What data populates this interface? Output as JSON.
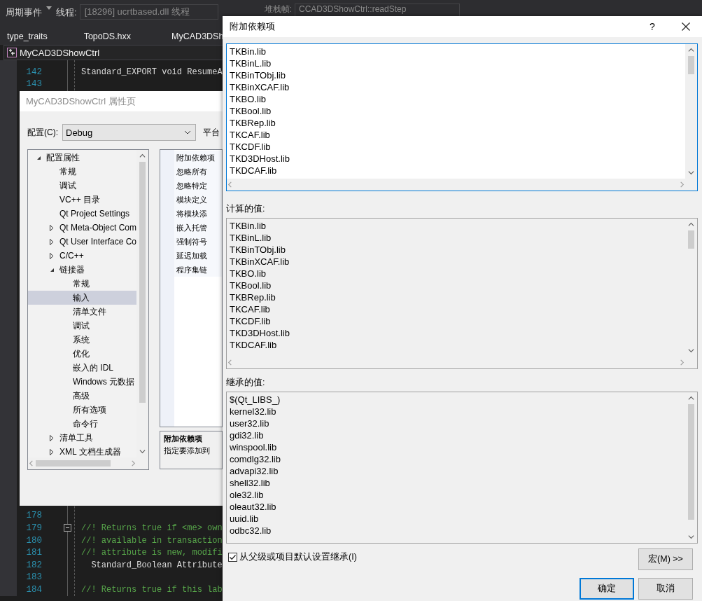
{
  "toolbar": {
    "event_label": "周期事件",
    "thread_label": "线程:",
    "thread_value": "[18296] ucrtbased.dll 线程",
    "frame_label": "堆栈帧:",
    "frame_value": "CCAD3DShowCtrl::readStep"
  },
  "editor_tabs": [
    {
      "label": "type_traits",
      "selected": false
    },
    {
      "label": "TopoDS.hxx",
      "selected": false
    },
    {
      "label": "MyCAD3DSh",
      "selected": false
    }
  ],
  "nav_bar": {
    "label": "MyCAD3DShowCtrl"
  },
  "code": {
    "lines_top": [
      {
        "number": "142",
        "text": "Standard_EXPORT void ResumeA",
        "kind": "code"
      },
      {
        "number": "143"
      }
    ],
    "lines_bottom": [
      {
        "number": "178"
      },
      {
        "number": "179",
        "text": "//! Returns true if <me> own",
        "kind": "comment",
        "fold": true
      },
      {
        "number": "180",
        "text": "//! available in transaction",
        "kind": "comment"
      },
      {
        "number": "181",
        "text": "//! attribute is new, modifi",
        "kind": "comment"
      },
      {
        "number": "182",
        "text": "  Standard_Boolean Attribute",
        "kind": "code"
      },
      {
        "number": "183"
      },
      {
        "number": "184",
        "text": "//! Returns true if this lab",
        "kind": "comment"
      }
    ]
  },
  "property_dialog": {
    "title": "MyCAD3DShowCtrl 属性页",
    "config_label": "配置(C):",
    "config_value": "Debug",
    "platform_label": "平台",
    "tree": [
      {
        "label": "配置属性",
        "selected": false,
        "expanded": true,
        "children": [
          {
            "label": "常规",
            "selected": false
          },
          {
            "label": "调试",
            "selected": false
          },
          {
            "label": "VC++ 目录",
            "selected": false
          },
          {
            "label": "Qt Project Settings",
            "selected": false
          },
          {
            "label": "Qt Meta-Object Com",
            "selected": false,
            "expanded": false
          },
          {
            "label": "Qt User Interface Co",
            "selected": false,
            "expanded": false
          },
          {
            "label": "C/C++",
            "selected": false,
            "expanded": false
          },
          {
            "label": "链接器",
            "selected": false,
            "expanded": true,
            "children": [
              {
                "label": "常规",
                "selected": false
              },
              {
                "label": "输入",
                "selected": true
              },
              {
                "label": "清单文件",
                "selected": false
              },
              {
                "label": "调试",
                "selected": false
              },
              {
                "label": "系统",
                "selected": false
              },
              {
                "label": "优化",
                "selected": false
              },
              {
                "label": "嵌入的 IDL",
                "selected": false
              },
              {
                "label": "Windows 元数据",
                "selected": false
              },
              {
                "label": "高级",
                "selected": false
              },
              {
                "label": "所有选项",
                "selected": false
              },
              {
                "label": "命令行",
                "selected": false
              }
            ]
          },
          {
            "label": "清单工具",
            "selected": false,
            "expanded": false
          },
          {
            "label": "XML 文档生成器",
            "selected": false,
            "expanded": false
          }
        ]
      }
    ],
    "properties": [
      "附加依赖项",
      "忽略所有",
      "忽略特定",
      "模块定义",
      "将模块添",
      "嵌入托管",
      "强制符号",
      "延迟加载",
      "程序集链"
    ],
    "description": {
      "title": "附加依赖项",
      "text": "指定要添加到"
    }
  },
  "dependencies_dialog": {
    "title": "附加依赖项",
    "help": "?",
    "edit_lines": [
      "TKBin.lib",
      "TKBinL.lib",
      "TKBinTObj.lib",
      "TKBinXCAF.lib",
      "TKBO.lib",
      "TKBool.lib",
      "TKBRep.lib",
      "TKCAF.lib",
      "TKCDF.lib",
      "TKD3DHost.lib",
      "TKDCAF.lib"
    ],
    "computed_label": "计算的值:",
    "computed_lines": [
      "TKBin.lib",
      "TKBinL.lib",
      "TKBinTObj.lib",
      "TKBinXCAF.lib",
      "TKBO.lib",
      "TKBool.lib",
      "TKBRep.lib",
      "TKCAF.lib",
      "TKCDF.lib",
      "TKD3DHost.lib",
      "TKDCAF.lib"
    ],
    "inherited_label": "继承的值:",
    "inherited_lines": [
      "$(Qt_LIBS_)",
      "kernel32.lib",
      "user32.lib",
      "gdi32.lib",
      "winspool.lib",
      "comdlg32.lib",
      "advapi32.lib",
      "shell32.lib",
      "ole32.lib",
      "oleaut32.lib",
      "uuid.lib",
      "odbc32.lib"
    ],
    "inherit_checkbox": {
      "label": "从父级或项目默认设置继承(I)",
      "checked": true
    },
    "buttons": [
      {
        "label": "宏(M) >>",
        "kind": "normal"
      },
      {
        "label": "确定",
        "kind": "default"
      },
      {
        "label": "取消",
        "kind": "normal"
      }
    ]
  }
}
